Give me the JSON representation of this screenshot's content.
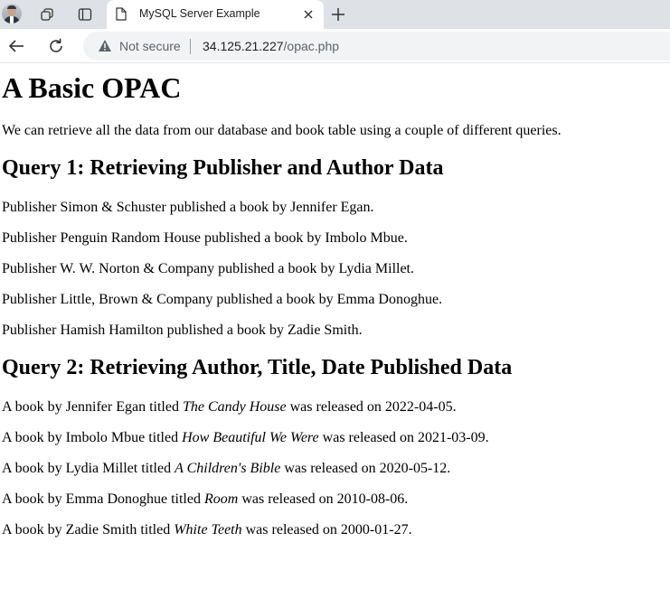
{
  "browser": {
    "tab_title": "MySQL Server Example",
    "security_label": "Not secure",
    "url_host": "34.125.21.227",
    "url_path": "/opac.php"
  },
  "page": {
    "title": "A Basic OPAC",
    "intro": "We can retrieve all the data from our database and book table using a couple of different queries.",
    "query1": {
      "heading": "Query 1: Retrieving Publisher and Author Data",
      "rows": [
        {
          "prefix": "Publisher ",
          "publisher": "Simon & Schuster",
          "mid": " published a book by ",
          "author": "Jennifer Egan",
          "suffix": "."
        },
        {
          "prefix": "Publisher ",
          "publisher": "Penguin Random House",
          "mid": " published a book by ",
          "author": "Imbolo Mbue",
          "suffix": "."
        },
        {
          "prefix": "Publisher ",
          "publisher": "W. W. Norton & Company",
          "mid": " published a book by ",
          "author": "Lydia Millet",
          "suffix": "."
        },
        {
          "prefix": "Publisher ",
          "publisher": "Little, Brown & Company",
          "mid": " published a book by ",
          "author": "Emma Donoghue",
          "suffix": "."
        },
        {
          "prefix": "Publisher ",
          "publisher": "Hamish Hamilton",
          "mid": " published a book by ",
          "author": "Zadie Smith",
          "suffix": "."
        }
      ]
    },
    "query2": {
      "heading": "Query 2: Retrieving Author, Title, Date Published Data",
      "rows": [
        {
          "prefix": "A book by ",
          "author": "Jennifer Egan",
          "mid": " titled ",
          "title": "The Candy House",
          "mid2": " was released on ",
          "date": "2022-04-05",
          "suffix": "."
        },
        {
          "prefix": "A book by ",
          "author": "Imbolo Mbue",
          "mid": " titled ",
          "title": "How Beautiful We Were",
          "mid2": " was released on ",
          "date": "2021-03-09",
          "suffix": "."
        },
        {
          "prefix": "A book by ",
          "author": "Lydia Millet",
          "mid": " titled ",
          "title": "A Children's Bible",
          "mid2": " was released on ",
          "date": "2020-05-12",
          "suffix": "."
        },
        {
          "prefix": "A book by ",
          "author": "Emma Donoghue",
          "mid": " titled ",
          "title": "Room",
          "mid2": " was released on ",
          "date": "2010-08-06",
          "suffix": "."
        },
        {
          "prefix": "A book by ",
          "author": "Zadie Smith",
          "mid": " titled ",
          "title": "White Teeth",
          "mid2": " was released on ",
          "date": "2000-01-27",
          "suffix": "."
        }
      ]
    }
  }
}
